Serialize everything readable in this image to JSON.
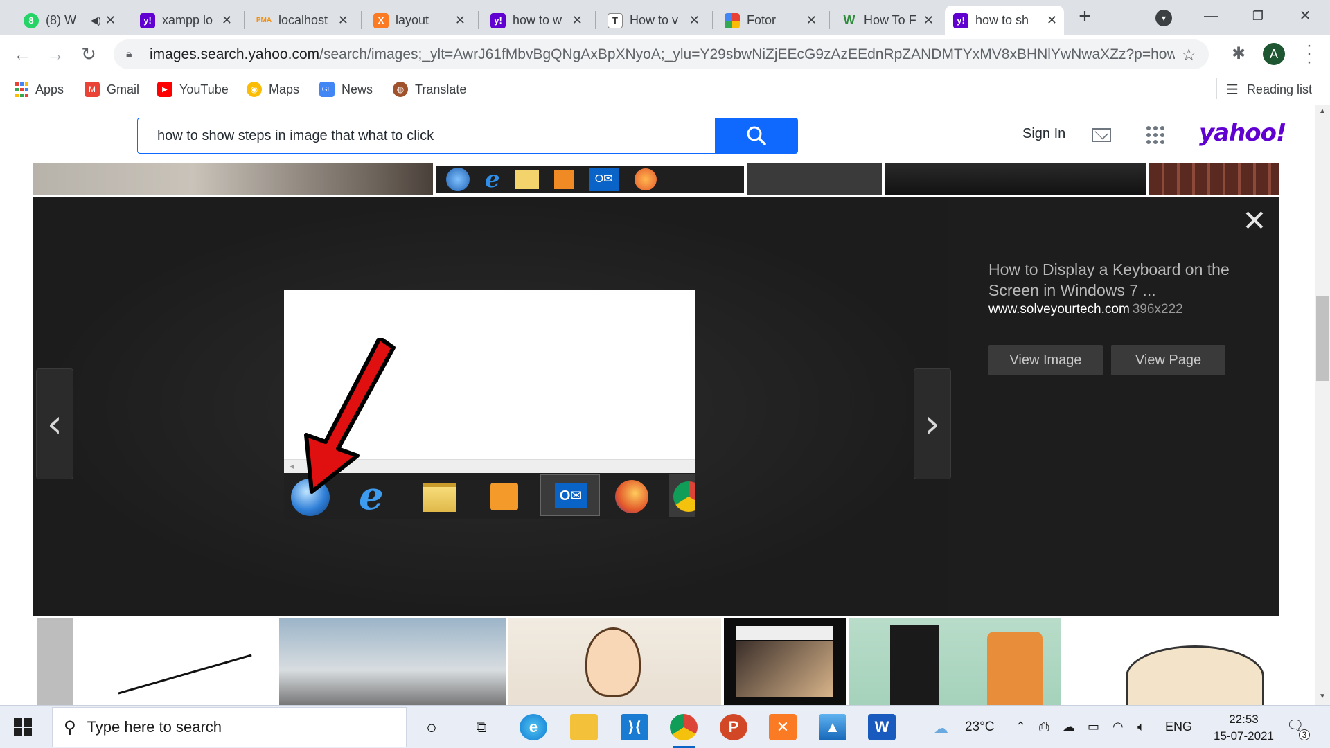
{
  "browser": {
    "tabs": [
      {
        "title": "(8) W",
        "favicon": "whatsapp-icon",
        "color": "#25d366",
        "glyph": "8",
        "muted_audio": true,
        "active": false
      },
      {
        "title": "xampp lo",
        "favicon": "yahoo-icon",
        "color": "#6001d2",
        "glyph": "y!",
        "active": false
      },
      {
        "title": "localhost",
        "favicon": "phpmyadmin-icon",
        "color": "#f29111",
        "glyph": "PMA",
        "active": false
      },
      {
        "title": "layout",
        "favicon": "xampp-icon",
        "color": "#fb7a24",
        "glyph": "X",
        "active": false
      },
      {
        "title": "how to w",
        "favicon": "yahoo-icon",
        "color": "#6001d2",
        "glyph": "y!",
        "active": false
      },
      {
        "title": "How to v",
        "favicon": "typography-icon",
        "color": "#444444",
        "glyph": "T",
        "active": false
      },
      {
        "title": "Fotor",
        "favicon": "fotor-icon",
        "color": "#e94235",
        "glyph": "",
        "active": false
      },
      {
        "title": "How To F",
        "favicon": "wikihow-icon",
        "color": "#2e8b3a",
        "glyph": "W",
        "active": false
      },
      {
        "title": "how to sh",
        "favicon": "yahoo-icon",
        "color": "#6001d2",
        "glyph": "y!",
        "active": true
      }
    ],
    "url_host": "images.search.yahoo.com",
    "url_path": "/search/images;_ylt=AwrJ61fMbvBgQNgAxBpXNyoA;_ylu=Y29sbwNiZjEEcG9zAzEEdnRpZANDMTYxMV8xBHNlYwNwaXZz?p=how+to...",
    "profile_initial": "A",
    "bookmarks": [
      {
        "label": "Apps",
        "icon": "apps-grid-icon"
      },
      {
        "label": "Gmail",
        "icon": "gmail-icon"
      },
      {
        "label": "YouTube",
        "icon": "youtube-icon"
      },
      {
        "label": "Maps",
        "icon": "maps-icon"
      },
      {
        "label": "News",
        "icon": "google-news-icon"
      },
      {
        "label": "Translate",
        "icon": "translate-icon"
      }
    ],
    "reading_list_label": "Reading list"
  },
  "yahoo": {
    "search_query": "how to show steps in image that what to click",
    "sign_in": "Sign In",
    "logo": "yahoo!",
    "lightbox": {
      "title": "How to Display a Keyboard on the Screen in Windows 7 ...",
      "source": "www.solveyourtech.com",
      "dimensions": "396x222",
      "view_image": "View Image",
      "view_page": "View Page"
    }
  },
  "taskbar": {
    "search_placeholder": "Type here to search",
    "temperature": "23°C",
    "language": "ENG",
    "time": "22:53",
    "date": "15-07-2021",
    "notification_count": "3",
    "pinned": [
      {
        "name": "cortana-icon"
      },
      {
        "name": "task-view-icon"
      },
      {
        "name": "edge-icon",
        "color": "#0c7bd4"
      },
      {
        "name": "file-explorer-icon",
        "color": "#f3c13a"
      },
      {
        "name": "vscode-icon",
        "color": "#1a7bd2"
      },
      {
        "name": "chrome-icon",
        "color": "#db4437"
      },
      {
        "name": "powerpoint-icon",
        "color": "#d24726"
      },
      {
        "name": "xampp-icon",
        "color": "#fb7a24"
      },
      {
        "name": "photos-icon",
        "color": "#1767b9"
      },
      {
        "name": "word-icon",
        "color": "#185abd"
      }
    ]
  }
}
